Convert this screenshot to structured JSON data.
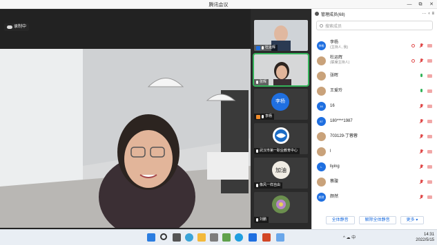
{
  "window": {
    "title": "腾讯会议",
    "minimize": "—",
    "maximize": "⧉",
    "close": "✕"
  },
  "recording": {
    "label": "录制中"
  },
  "main_speaker": {
    "name": "张晖"
  },
  "thumbnails": [
    {
      "name": "杜运辉",
      "kind": "photo"
    },
    {
      "name": "张晖",
      "kind": "photo",
      "active": true
    },
    {
      "name": "李杨",
      "kind": "avatar",
      "avatar_text": "李杨"
    },
    {
      "name": "武汉市第一职业教育中心",
      "kind": "logo"
    },
    {
      "name": "像风一样自由",
      "kind": "logo2"
    },
    {
      "name": "刘鹏",
      "kind": "flower"
    }
  ],
  "panel": {
    "title": "管理成员(68)",
    "more": "···",
    "collapse": "‹",
    "menu": "≡",
    "search_placeholder": "搜索成员",
    "members": [
      {
        "avatar": "李杨",
        "name": "李杨",
        "sub": "(主持人, 我)",
        "mic": "muted",
        "cam": "off",
        "rec": true,
        "photo": false
      },
      {
        "avatar": "",
        "name": "杜运辉",
        "sub": "(联席主持人)",
        "mic": "muted",
        "cam": "off",
        "rec": true,
        "photo": true
      },
      {
        "avatar": "",
        "name": "张晖",
        "sub": "",
        "mic": "on",
        "cam": "off",
        "rec": false,
        "photo": true
      },
      {
        "avatar": "",
        "name": "王爱玲",
        "sub": "",
        "mic": "on",
        "cam": "off",
        "rec": false,
        "photo": true
      },
      {
        "avatar": "16",
        "name": "16",
        "sub": "",
        "mic": "muted",
        "cam": "off",
        "rec": false,
        "photo": false
      },
      {
        "avatar": "87",
        "name": "180****1987",
        "sub": "",
        "mic": "muted",
        "cam": "off",
        "rec": false,
        "photo": false
      },
      {
        "avatar": "",
        "name": "703129-丁蓉蓉",
        "sub": "",
        "mic": "muted",
        "cam": "off",
        "rec": false,
        "photo": true
      },
      {
        "avatar": "",
        "name": "l",
        "sub": "",
        "mic": "muted",
        "cam": "off",
        "rec": false,
        "photo": true
      },
      {
        "avatar": "L",
        "name": "liying",
        "sub": "",
        "mic": "muted",
        "cam": "off",
        "rec": false,
        "photo": false
      },
      {
        "avatar": "",
        "name": "蔡璇",
        "sub": "",
        "mic": "muted",
        "cam": "off",
        "rec": false,
        "photo": true
      },
      {
        "avatar": "颜然",
        "name": "颜然",
        "sub": "",
        "mic": "muted",
        "cam": "off",
        "rec": false,
        "photo": false
      }
    ],
    "buttons": {
      "mute_all": "全体静音",
      "unmute_all": "解除全体静音",
      "more": "更多 ▾"
    }
  },
  "taskbar": {
    "tray_text": "^  ☁  中",
    "time": "14:31",
    "date": "2022/5/15"
  },
  "colors": {
    "accent": "#1f6fe0",
    "active": "#34b35a",
    "danger": "#e04b4b"
  }
}
